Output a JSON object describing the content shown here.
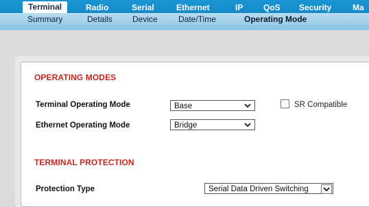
{
  "top_tabs": [
    {
      "label": "Terminal",
      "active": true
    },
    {
      "label": "Radio",
      "active": false
    },
    {
      "label": "Serial",
      "active": false
    },
    {
      "label": "Ethernet",
      "active": false
    },
    {
      "label": "IP",
      "active": false
    },
    {
      "label": "QoS",
      "active": false
    },
    {
      "label": "Security",
      "active": false
    },
    {
      "label": "Ma",
      "active": false
    }
  ],
  "sub_tabs": [
    {
      "label": "Summary",
      "active": false
    },
    {
      "label": "Details",
      "active": false
    },
    {
      "label": "Device",
      "active": false
    },
    {
      "label": "Date/Time",
      "active": false
    },
    {
      "label": "Operating Mode",
      "active": true
    }
  ],
  "operating_modes": {
    "title": "OPERATING MODES",
    "terminal_label": "Terminal Operating Mode",
    "terminal_value": "Base",
    "sr_compatible_label": "SR Compatible",
    "sr_compatible_checked": false,
    "ethernet_label": "Ethernet Operating Mode",
    "ethernet_value": "Bridge"
  },
  "terminal_protection": {
    "title": "TERMINAL PROTECTION",
    "protection_label": "Protection Type",
    "protection_value": "Serial Data Driven Switching"
  },
  "colors": {
    "nav_blue": "#1a95d3",
    "section_red": "#c8251d"
  }
}
